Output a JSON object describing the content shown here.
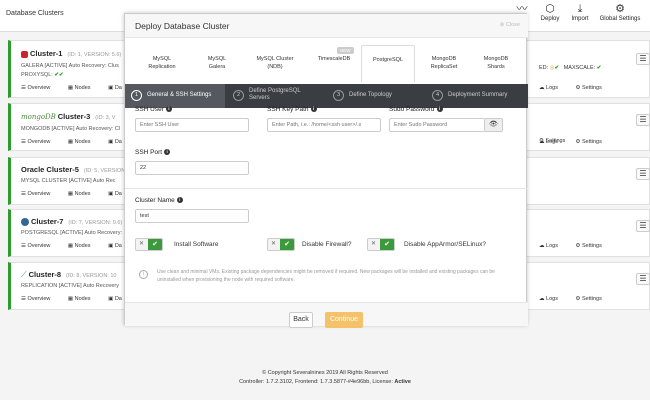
{
  "topbar": {
    "title": "Database Clusters",
    "activity_label": "ty",
    "deploy_label": "Deploy",
    "import_label": "Import",
    "global_settings_label": "Global Settings"
  },
  "clusters": [
    {
      "name": "Cluster-1",
      "meta": "(ID: 1, VERSION: 5.6)",
      "line1": "GALERA [ACTIVE]   Auto Recovery: Clus",
      "line2": "PROXYSQL:",
      "topright": "ED:",
      "maxscale": "MAXSCALE:",
      "actions": [
        "Overview",
        "Nodes",
        "Da"
      ],
      "right_actions": [
        "Logs",
        "Settings"
      ]
    },
    {
      "name": "Cluster-3",
      "logo_text": "mongoDB",
      "meta": "(ID: 3, V",
      "line1": "MONGODB [ACTIVE]   Auto Recovery: Cl",
      "actions": [
        "Overview",
        "Nodes",
        "Da"
      ],
      "right_actions": [
        "Logs",
        "Settings"
      ]
    },
    {
      "name": "Oracle Cluster-5",
      "meta": "(ID: 5, VERSION: 5",
      "line1": "MYSQL CLUSTER [ACTIVE]   Auto Rec",
      "actions": [
        "Overview",
        "Nodes",
        "Da"
      ],
      "right_actions": [
        "Settings"
      ]
    },
    {
      "name": "Cluster-7",
      "meta": "(ID: 7, VERSION: 9.6)",
      "line1": "POSTGRESQL [ACTIVE]   Auto Recovery:",
      "actions": [
        "Overview",
        "Nodes",
        "Da"
      ],
      "right_actions": [
        "Logs",
        "Settings"
      ]
    },
    {
      "name": "Cluster-8",
      "meta": "(ID: 8, VERSION: 10",
      "line1": "REPLICATION [ACTIVE]   Auto Recovery",
      "actions": [
        "Overview",
        "Nodes",
        "Da"
      ],
      "right_actions": [
        "Logs",
        "Settings"
      ]
    }
  ],
  "footer": {
    "copyright": "© Copyright Severalnines 2019 All Rights Reserved",
    "version_line": "Controller: 1.7.2.3102, Frontend: 1.7.3.5877-#4e96bb, License:",
    "license_status": "Active"
  },
  "modal": {
    "title": "Deploy Database Cluster",
    "close_label": "Close",
    "db_tabs": [
      {
        "line1": "MySQL",
        "line2": "Replication"
      },
      {
        "line1": "MySQL",
        "line2": "Galera"
      },
      {
        "line1": "MySQL Cluster",
        "line2": "(NDB)"
      },
      {
        "line1": "TimescaleDB",
        "line2": "",
        "badge": "NEW"
      },
      {
        "line1": "PostgreSQL",
        "line2": ""
      },
      {
        "line1": "MongoDB",
        "line2": "ReplicaSet"
      },
      {
        "line1": "MongoDB",
        "line2": "Shards"
      }
    ],
    "active_tab": "PostgreSQL",
    "steps": [
      {
        "num": "1",
        "line1": "General & SSH Settings",
        "line2": ""
      },
      {
        "num": "2",
        "line1": "Define PostgreSQL",
        "line2": "Servers"
      },
      {
        "num": "3",
        "line1": "Define Topology",
        "line2": ""
      },
      {
        "num": "4",
        "line1": "Deployment Summary",
        "line2": ""
      }
    ],
    "form": {
      "ssh_user_label": "SSH User",
      "ssh_user_placeholder": "Enter SSH User",
      "ssh_key_label": "SSH Key Path",
      "ssh_key_placeholder": "Enter Path, i.e.: /home/<ssh user>/.s",
      "sudo_label": "Sudo Password",
      "sudo_placeholder": "Enter Sudo Password",
      "ssh_port_label": "SSH Port",
      "ssh_port_value": "22",
      "cluster_name_label": "Cluster Name",
      "cluster_name_value": "test",
      "install_software_label": "Install Software",
      "disable_firewall_label": "Disable Firewall?",
      "disable_apparmor_label": "Disable AppArmor/SELinux?",
      "notice": "Use clean and minimal VMs. Existing package dependencies might be removed if required. New packages will be installed and existing packages can be uninstalled when provisioning the node with required software."
    },
    "back_label": "Back",
    "continue_label": "Continue"
  }
}
